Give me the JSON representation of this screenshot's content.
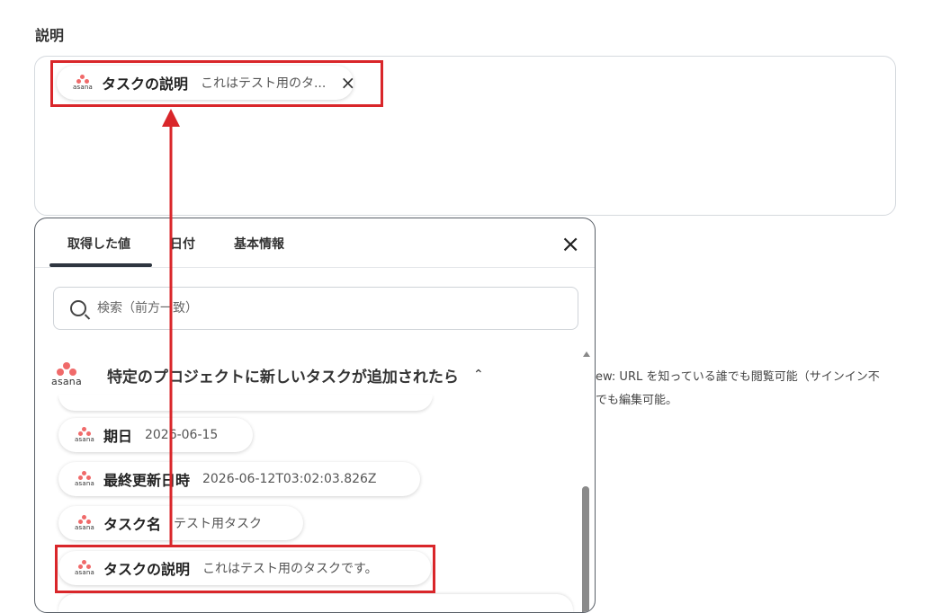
{
  "field": {
    "label": "説明"
  },
  "selected_chip": {
    "label": "タスクの説明",
    "value": "これはテスト用のタ...",
    "close_icon": "×"
  },
  "picker": {
    "tabs": [
      {
        "label": "取得した値"
      },
      {
        "label": "日付"
      },
      {
        "label": "基本情報"
      }
    ],
    "active_tab": "取得した値",
    "close_icon": "×",
    "search": {
      "placeholder": "検索（前方一致）"
    },
    "group": {
      "title": "特定のプロジェクトに新しいタスクが追加されたら",
      "chevron": "⌃"
    },
    "items": [
      {
        "label": "期日",
        "value": "2026-06-15"
      },
      {
        "label": "最終更新日時",
        "value": "2026-06-12T03:02:03.826Z"
      },
      {
        "label": "タスク名",
        "value": "テスト用タスク"
      },
      {
        "label": "タスクの説明",
        "value": "これはテスト用のタスクです。"
      }
    ]
  },
  "logo": {
    "word": "asana"
  },
  "background_text": {
    "line1": "ew: URL を知っている誰でも閲覧可能（サインイン不",
    "line2": "でも編集可能。"
  },
  "colors": {
    "highlight": "#d9262a",
    "asana_coral": "#f06a6a"
  }
}
